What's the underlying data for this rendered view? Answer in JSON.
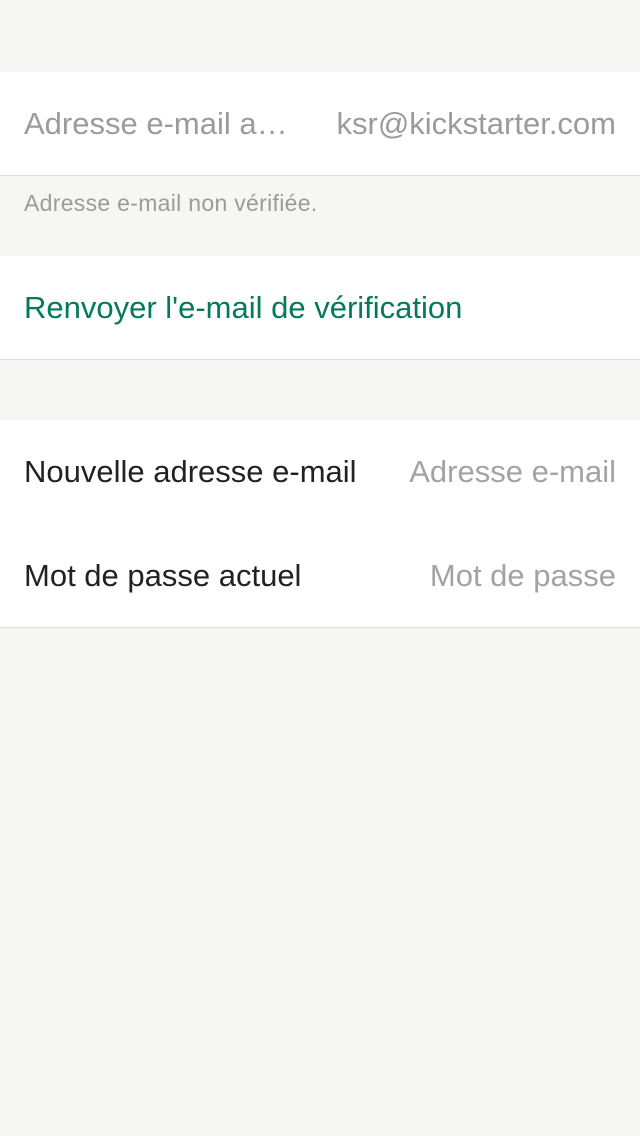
{
  "current_email": {
    "label": "Adresse e-mail actuelle",
    "value": "ksr@kickstarter.com"
  },
  "status_note": "Adresse e-mail non vérifiée.",
  "resend_link": "Renvoyer l'e-mail de vérification",
  "form": {
    "new_email": {
      "label": "Nouvelle adresse e-mail",
      "placeholder": "Adresse e-mail"
    },
    "current_password": {
      "label": "Mot de passe actuel",
      "placeholder": "Mot de passe"
    }
  },
  "colors": {
    "background": "#f6f6f4",
    "accent": "#037a5c",
    "muted_text": "#9b9b9b",
    "primary_text": "#222222"
  }
}
